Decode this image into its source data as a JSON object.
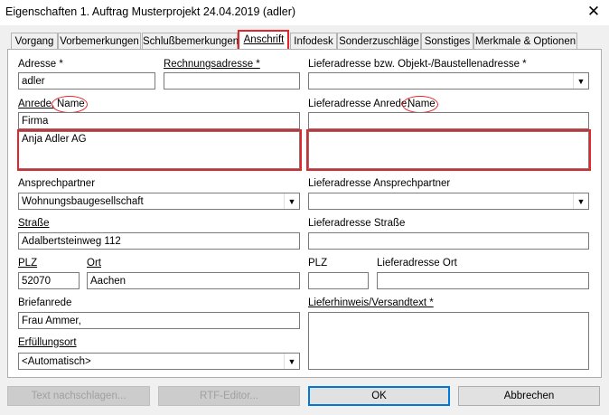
{
  "window": {
    "title": "Eigenschaften 1. Auftrag Musterprojekt 24.04.2019 (adler)",
    "close_glyph": "✕"
  },
  "tabs": [
    "Vorgang",
    "Vorbemerkungen",
    "Schlußbemerkungen",
    "Anschrift",
    "Infodesk",
    "Sonderzuschläge",
    "Sonstiges",
    "Merkmale & Optionen"
  ],
  "active_tab": "Anschrift",
  "form": {
    "adresse_label": "Adresse *",
    "adresse_value": "adler",
    "rechnungsadresse_label": "Rechnungsadresse *",
    "rechnungsadresse_value": "",
    "lieferadresse_label": "Lieferadresse bzw. Objekt-/Baustellenadresse *",
    "lieferadresse_value": "",
    "anrede_label": "Anrede,",
    "anrede_name_label": "Name",
    "anrede_value": "Firma",
    "name_value": "Anja Adler AG",
    "lief_anrede_label": "Lieferadresse Anrede,",
    "lief_anrede_name_label": "Name",
    "lief_anrede_value": "",
    "lief_name_value": "",
    "ansprechpartner_label": "Ansprechpartner",
    "ansprechpartner_value": "Wohnungsbaugesellschaft",
    "lief_ansprechpartner_label": "Lieferadresse Ansprechpartner",
    "lief_ansprechpartner_value": "",
    "strasse_label": "Straße",
    "strasse_value": "Adalbertsteinweg 112",
    "lief_strasse_label": "Lieferadresse Straße",
    "lief_strasse_value": "",
    "plz_label": "PLZ",
    "plz_value": "52070",
    "ort_label": "Ort",
    "ort_value": "Aachen",
    "lief_plz_label": "PLZ",
    "lief_plz_value": "",
    "lief_ort_label": "Lieferadresse Ort",
    "lief_ort_value": "",
    "briefanrede_label": "Briefanrede",
    "briefanrede_value": "Frau Ammer,",
    "lieferhinweis_label": "Lieferhinweis/Versandtext *",
    "lieferhinweis_value": "",
    "erfuellungsort_label": "Erfüllungsort",
    "erfuellungsort_value": "<Automatisch>"
  },
  "buttons": {
    "text_nachschlagen": "Text nachschlagen...",
    "rtf_editor": "RTF-Editor...",
    "ok": "OK",
    "abbrechen": "Abbrechen"
  },
  "colors": {
    "highlight": "#e4262c",
    "focus_border": "#0078d7"
  }
}
